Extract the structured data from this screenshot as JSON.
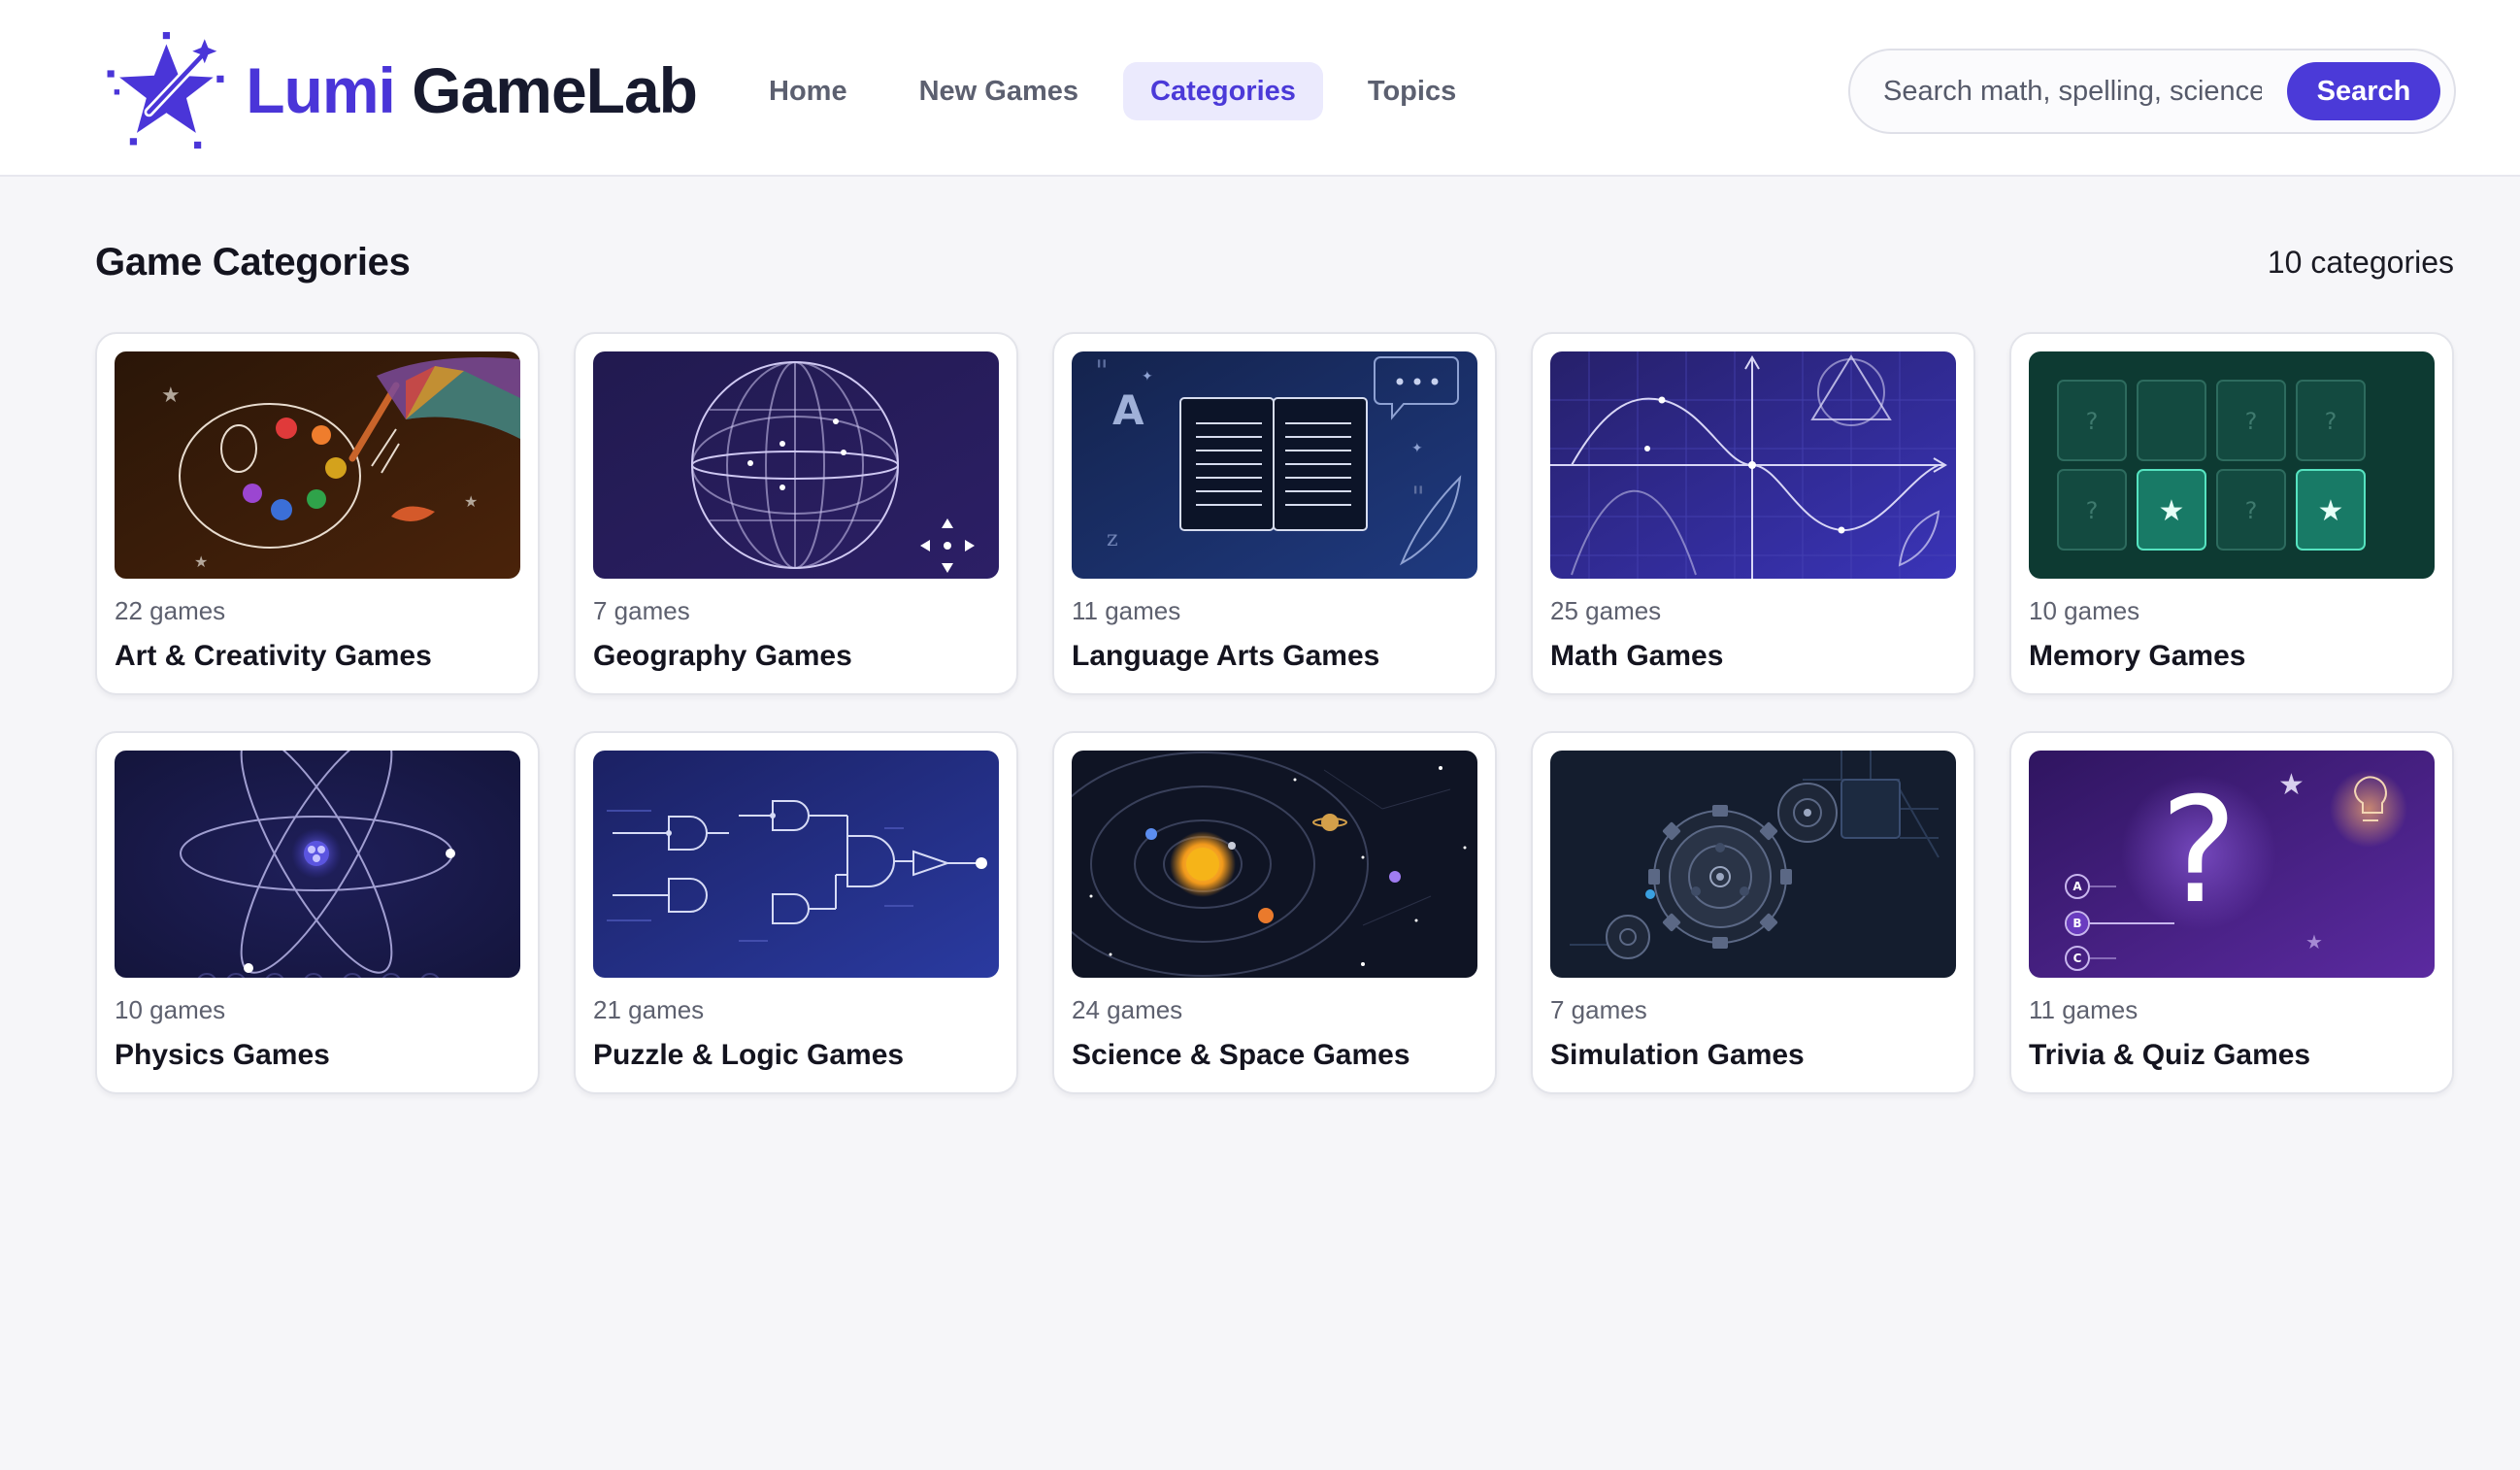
{
  "header": {
    "logo": {
      "word1": "Lumi",
      "word2": "GameLab",
      "icon": "sparkle-star-icon",
      "accent": "#4a35d8"
    },
    "nav": [
      {
        "label": "Home",
        "active": false
      },
      {
        "label": "New Games",
        "active": false
      },
      {
        "label": "Categories",
        "active": true
      },
      {
        "label": "Topics",
        "active": false
      }
    ],
    "search": {
      "placeholder": "Search math, spelling, science...",
      "value": "",
      "button_label": "Search"
    }
  },
  "main": {
    "title": "Game Categories",
    "count": "10 categories",
    "categories": [
      {
        "name": "Art & Creativity Games",
        "games": "22 games",
        "icon": "paint-palette-icon"
      },
      {
        "name": "Geography Games",
        "games": "7 games",
        "icon": "globe-icon"
      },
      {
        "name": "Language Arts Games",
        "games": "11 games",
        "icon": "open-book-icon"
      },
      {
        "name": "Math Games",
        "games": "25 games",
        "icon": "sine-wave-graph-icon"
      },
      {
        "name": "Memory Games",
        "games": "10 games",
        "icon": "memory-cards-icon"
      },
      {
        "name": "Physics Games",
        "games": "10 games",
        "icon": "atom-icon"
      },
      {
        "name": "Puzzle & Logic Games",
        "games": "21 games",
        "icon": "logic-gates-icon"
      },
      {
        "name": "Science & Space Games",
        "games": "24 games",
        "icon": "solar-system-icon"
      },
      {
        "name": "Simulation Games",
        "games": "7 games",
        "icon": "gears-icon"
      },
      {
        "name": "Trivia & Quiz Games",
        "games": "11 games",
        "icon": "question-mark-icon"
      }
    ]
  },
  "colors": {
    "accent": "#4b3ad8",
    "nav_active_bg": "#ebeafd",
    "page_bg": "#f6f6f9"
  }
}
